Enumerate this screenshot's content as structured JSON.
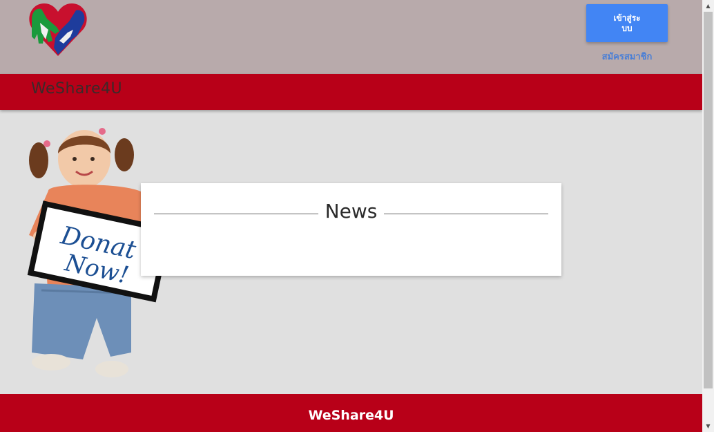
{
  "header": {
    "login_button": "เข้าสู่ระบบ",
    "register_link": "สมัครสมาชิก"
  },
  "nav": {
    "brand": "WeShare4U"
  },
  "hero": {
    "sign_text_line1": "Donat",
    "sign_text_line2": "Now!"
  },
  "news": {
    "title": "News"
  },
  "footer": {
    "brand": "WeShare4U"
  },
  "icons": {
    "logo": "heart-hands-logo",
    "scroll_up": "scroll-up-arrow-icon",
    "scroll_down": "scroll-down-arrow-icon"
  },
  "colors": {
    "header_bg": "#b8aaab",
    "nav_red": "#b80018",
    "login_blue": "#4285f4",
    "page_bg": "#e0e0e0"
  }
}
